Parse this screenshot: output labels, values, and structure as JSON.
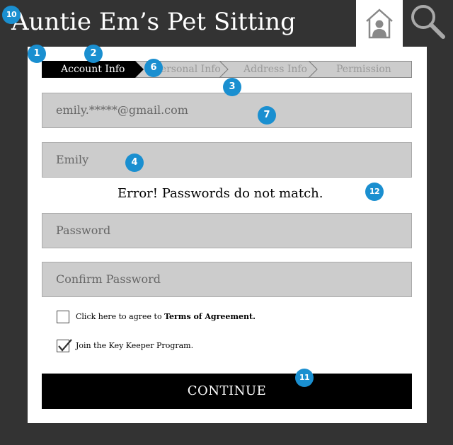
{
  "app": {
    "title": "Auntie Em’s Pet Sitting"
  },
  "header": {
    "home_icon": "home-person-icon",
    "search_icon": "search-icon"
  },
  "steps": [
    {
      "label": "Account Info",
      "active": true
    },
    {
      "label": "Personal Info",
      "active": false
    },
    {
      "label": "Address Info",
      "active": false
    },
    {
      "label": "Permission",
      "active": false
    }
  ],
  "form": {
    "email_value": "emily.*****@gmail.com",
    "name_value": "Emily",
    "error_message": "Error! Passwords do not match.",
    "password_placeholder": "Password",
    "confirm_password_placeholder": "Confirm Password",
    "terms": {
      "prefix": "Click here to agree to ",
      "link": "Terms of Agreement.",
      "checked": false
    },
    "key_keeper": {
      "label": "Join the Key Keeper Program.",
      "checked": true
    },
    "continue_label": "CONTINUE"
  },
  "annotations": [
    "1",
    "2",
    "3",
    "4",
    "6",
    "7",
    "10",
    "11",
    "12"
  ],
  "colors": {
    "badge": "#1a8fd0",
    "background": "#333333",
    "field": "#cccccc",
    "button": "#000000"
  }
}
